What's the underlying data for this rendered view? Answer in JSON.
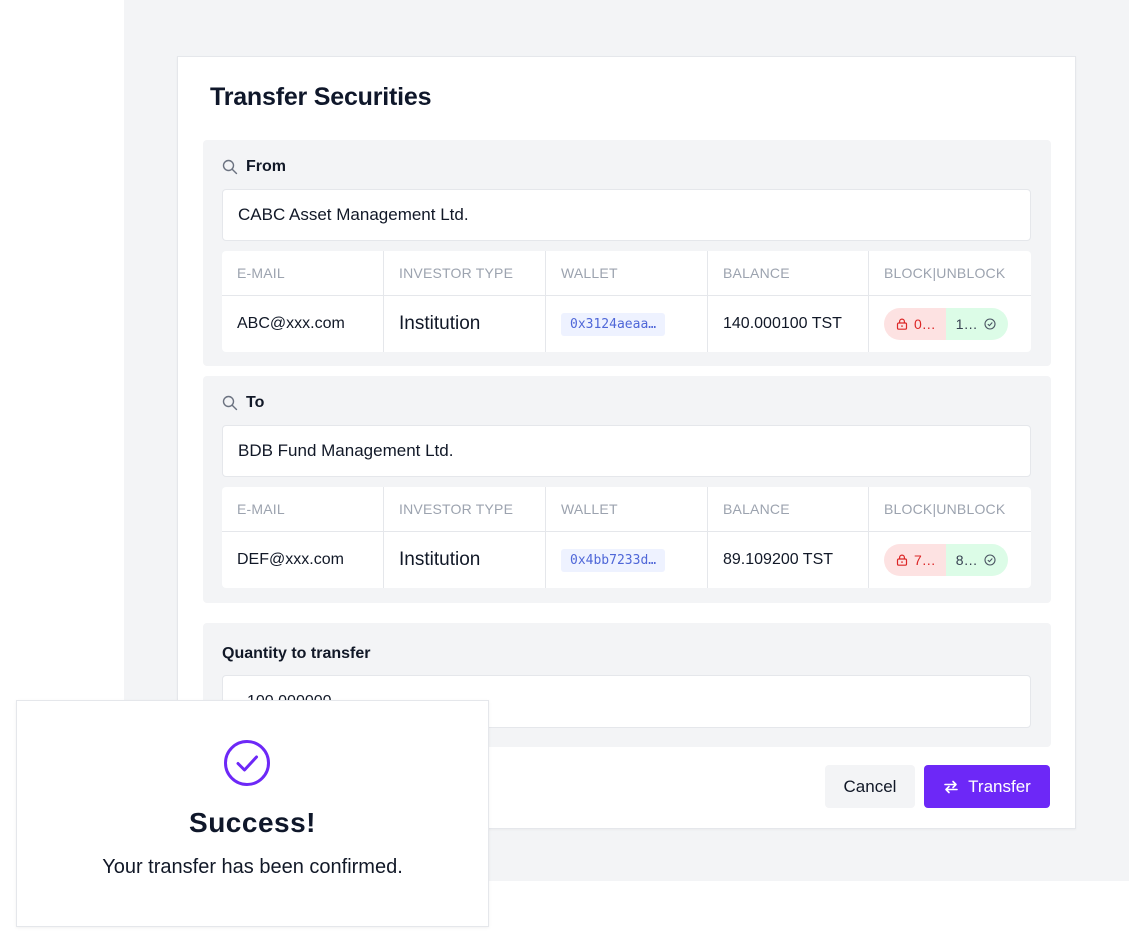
{
  "modal": {
    "title": "Transfer Securities"
  },
  "from": {
    "label": "From",
    "entity": "CABC Asset Management Ltd.",
    "headers": [
      "E-MAIL",
      "INVESTOR TYPE",
      "WALLET",
      "BALANCE",
      "BLOCK|UNBLOCK"
    ],
    "email": "ABC@xxx.com",
    "investor_type": "Institution",
    "wallet": "0x3124aeaa…",
    "balance": "140.000100 TST",
    "blocked": "0…",
    "unblocked": "1…"
  },
  "to": {
    "label": "To",
    "entity": "BDB Fund Management Ltd.",
    "headers": [
      "E-MAIL",
      "INVESTOR TYPE",
      "WALLET",
      "BALANCE",
      "BLOCK|UNBLOCK"
    ],
    "email": "DEF@xxx.com",
    "investor_type": "Institution",
    "wallet": "0x4bb7233d…",
    "balance": "89.109200 TST",
    "blocked": "7…",
    "unblocked": "8…"
  },
  "quantity": {
    "label": "Quantity to transfer",
    "value": "100.000000"
  },
  "actions": {
    "cancel_label": "Cancel",
    "transfer_label": "Transfer"
  },
  "toast": {
    "title": "Success!",
    "message": "Your transfer has been confirmed."
  },
  "colors": {
    "accent": "#6d28f7",
    "block_bg": "#fde2e2",
    "unblock_bg": "#dcfce7",
    "wallet_text": "#4f67d8"
  },
  "icons": [
    "search-icon",
    "lock-icon",
    "check-circle-icon",
    "transfer-arrows-icon"
  ]
}
